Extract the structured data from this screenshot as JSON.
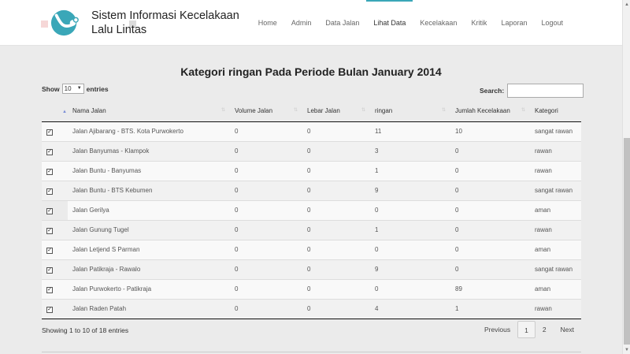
{
  "brand": {
    "line1": "Sistem Informasi Kecelakaan",
    "line2": "Lalu Lintas"
  },
  "nav": [
    {
      "label": "Home",
      "active": false
    },
    {
      "label": "Admin",
      "active": false
    },
    {
      "label": "Data Jalan",
      "active": false
    },
    {
      "label": "Lihat Data",
      "active": true
    },
    {
      "label": "Kecelakaan",
      "active": false
    },
    {
      "label": "Kritik",
      "active": false
    },
    {
      "label": "Laporan",
      "active": false
    },
    {
      "label": "Logout",
      "active": false
    }
  ],
  "colors": {
    "accent": "#3aa7b8",
    "logo": "#3aa7b8",
    "sort_active": "#7a8dd6"
  },
  "page_title": "Kategori ringan Pada Periode Bulan January 2014",
  "length": {
    "show_label": "Show",
    "value": "10",
    "entries_label": "entries"
  },
  "search": {
    "label": "Search:",
    "value": ""
  },
  "table": {
    "headers": [
      "",
      "Nama Jalan",
      "Volume Jalan",
      "Lebar Jalan",
      "ringan",
      "Jumlah Kecelakaan",
      "Kategori"
    ],
    "rows": [
      [
        "Jalan Ajibarang - BTS. Kota Purwokerto",
        "0",
        "0",
        "11",
        "10",
        "sangat rawan"
      ],
      [
        "Jalan Banyumas - Klampok",
        "0",
        "0",
        "3",
        "0",
        "rawan"
      ],
      [
        "Jalan Buntu - Banyumas",
        "0",
        "0",
        "1",
        "0",
        "rawan"
      ],
      [
        "Jalan Buntu - BTS Kebumen",
        "0",
        "0",
        "9",
        "0",
        "sangat rawan"
      ],
      [
        "Jalan Gerilya",
        "0",
        "0",
        "0",
        "0",
        "aman"
      ],
      [
        "Jalan Gunung Tugel",
        "0",
        "0",
        "1",
        "0",
        "rawan"
      ],
      [
        "Jalan Letjend S Parman",
        "0",
        "0",
        "0",
        "0",
        "aman"
      ],
      [
        "Jalan Patikraja - Rawalo",
        "0",
        "0",
        "9",
        "0",
        "sangat rawan"
      ],
      [
        "Jalan Purwokerto - Patikraja",
        "0",
        "0",
        "0",
        "89",
        "aman"
      ],
      [
        "Jalan Raden Patah",
        "0",
        "0",
        "4",
        "1",
        "rawan"
      ]
    ]
  },
  "info": "Showing 1 to 10 of 18 entries",
  "pagination": {
    "previous": "Previous",
    "pages": [
      "1",
      "2"
    ],
    "current": "1",
    "next": "Next"
  }
}
